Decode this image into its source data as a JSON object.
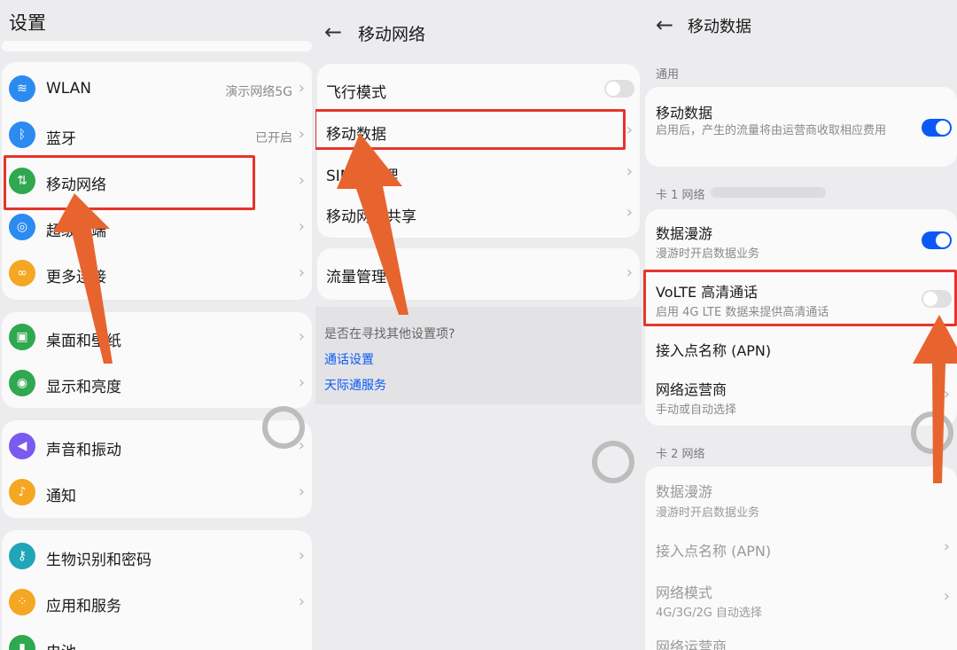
{
  "panel1": {
    "title": "设置",
    "group1": [
      {
        "label": "WLAN",
        "value": "演示网络5G",
        "icon": "wifi-icon",
        "color": "#2b8bf0"
      },
      {
        "label": "蓝牙",
        "value": "已开启",
        "icon": "bluetooth-icon",
        "color": "#2b8bf0"
      },
      {
        "label": "移动网络",
        "value": "",
        "icon": "mobile-network-icon",
        "color": "#2fa84f"
      },
      {
        "label": "超级终端",
        "value": "",
        "icon": "super-device-icon",
        "color": "#2b8bf0"
      },
      {
        "label": "更多连接",
        "value": "",
        "icon": "link-icon",
        "color": "#f5a623"
      }
    ],
    "group2": [
      {
        "label": "桌面和壁纸",
        "icon": "wallpaper-icon",
        "color": "#2fa84f"
      },
      {
        "label": "显示和亮度",
        "icon": "eye-icon",
        "color": "#2fa84f"
      }
    ],
    "group3": [
      {
        "label": "声音和振动",
        "icon": "speaker-icon",
        "color": "#7b5af0"
      },
      {
        "label": "通知",
        "icon": "bell-icon",
        "color": "#f5a623"
      }
    ],
    "group4": [
      {
        "label": "生物识别和密码",
        "icon": "key-icon",
        "color": "#20a6b8"
      },
      {
        "label": "应用和服务",
        "icon": "apps-icon",
        "color": "#f5a623"
      },
      {
        "label": "电池",
        "icon": "battery-icon",
        "color": "#2fa84f"
      }
    ]
  },
  "panel2": {
    "title": "移动网络",
    "items": [
      {
        "label": "飞行模式",
        "toggle": false
      },
      {
        "label": "移动数据"
      },
      {
        "label": "SIM卡管理"
      },
      {
        "label": "移动网络共享"
      }
    ],
    "item2": {
      "label": "流量管理"
    },
    "hint": "是否在寻找其他设置项?",
    "links": [
      "通话设置",
      "天际通服务"
    ]
  },
  "panel3": {
    "title": "移动数据",
    "general_head": "通用",
    "mobile_data": {
      "label": "移动数据",
      "desc": "启用后，产生的流量将由运营商收取相应费用",
      "toggle": true
    },
    "card1_head": "卡 1 网络",
    "card1": [
      {
        "label": "数据漫游",
        "desc": "漫游时开启数据业务",
        "toggle": true
      },
      {
        "label": "VoLTE 高清通话",
        "desc": "启用 4G LTE 数据来提供高清通话",
        "toggle": false
      },
      {
        "label": "接入点名称 (APN)",
        "desc": ""
      },
      {
        "label": "网络运营商",
        "desc": "手动或自动选择"
      }
    ],
    "card2_head": "卡 2 网络",
    "card2": [
      {
        "label": "数据漫游",
        "desc": "漫游时开启数据业务"
      },
      {
        "label": "接入点名称 (APN)",
        "desc": ""
      },
      {
        "label": "网络模式",
        "desc": "4G/3G/2G 自动选择"
      },
      {
        "label": "网络运营商",
        "desc": ""
      }
    ]
  },
  "colors": {
    "accent": "#0a59f7",
    "highlight": "#e5352b",
    "arrow": "#e8642f"
  }
}
